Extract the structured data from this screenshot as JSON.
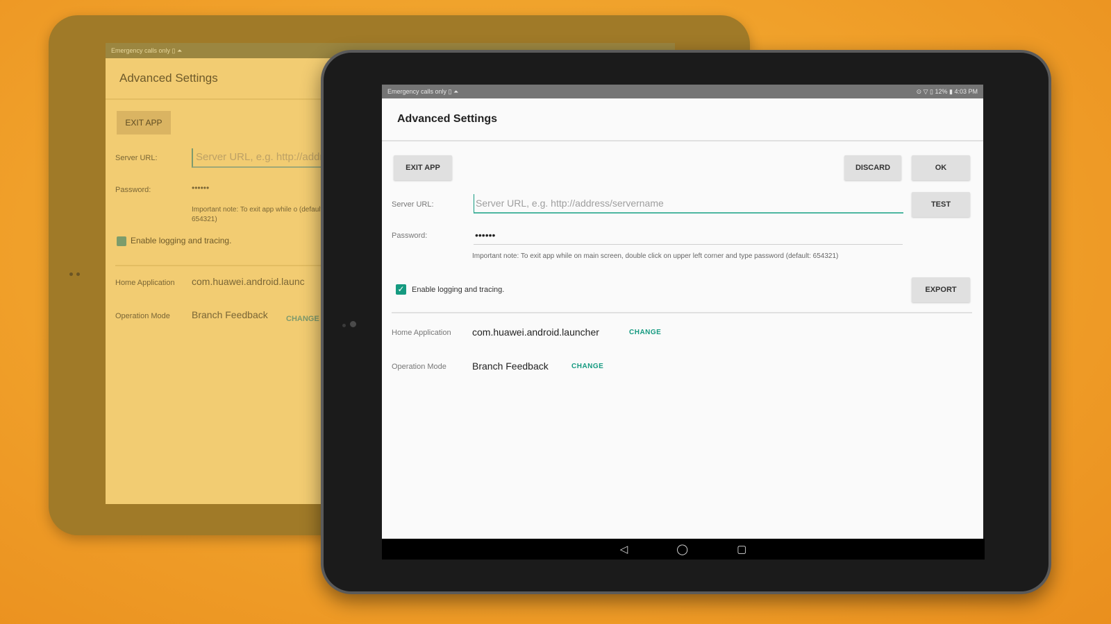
{
  "screen": {
    "status_bar": {
      "left": "Emergency calls only ▯ ⏶",
      "right": "⊙ ▽ ▯ 12% ▮ 4:03 PM"
    },
    "app_bar": {
      "title": "Advanced Settings"
    },
    "buttons": {
      "exit_app": "EXIT APP",
      "discard": "DISCARD",
      "ok": "OK",
      "test": "TEST",
      "export": "EXPORT"
    },
    "server_url": {
      "label": "Server URL:",
      "placeholder": "Server URL, e.g. http://address/servername",
      "value": ""
    },
    "password": {
      "label": "Password:",
      "value": "••••••",
      "note": "Important note: To exit app while on main screen, double click on upper left corner and type password (default: 654321)"
    },
    "logging": {
      "label": "Enable logging and tracing.",
      "checked": true
    },
    "home_application": {
      "label": "Home Application",
      "value": "com.huawei.android.launcher",
      "action": "CHANGE"
    },
    "operation_mode": {
      "label": "Operation Mode",
      "value": "Branch Feedback",
      "action": "CHANGE"
    },
    "nav_icons": [
      "back-icon",
      "home-icon",
      "recents-icon"
    ]
  },
  "background_screen": {
    "status_left": "Emergency calls only ▯ ⏶",
    "title": "Advanced Settings",
    "exit_app": "EXIT APP",
    "server_url_label": "Server URL:",
    "server_url_placeholder": "Server URL, e.g. http://addr",
    "password_label": "Password:",
    "password_value": "••••••",
    "note": "Important note: To exit app while o (default: 654321)",
    "logging_label": "Enable logging and tracing.",
    "home_label": "Home Application",
    "home_value": "com.huawei.android.launc",
    "mode_label": "Operation Mode",
    "mode_value": "Branch Feedback",
    "mode_action": "CHANGE"
  },
  "colors": {
    "accent": "#159a80",
    "background": "#f0a02a",
    "status_bar": "#757575"
  }
}
